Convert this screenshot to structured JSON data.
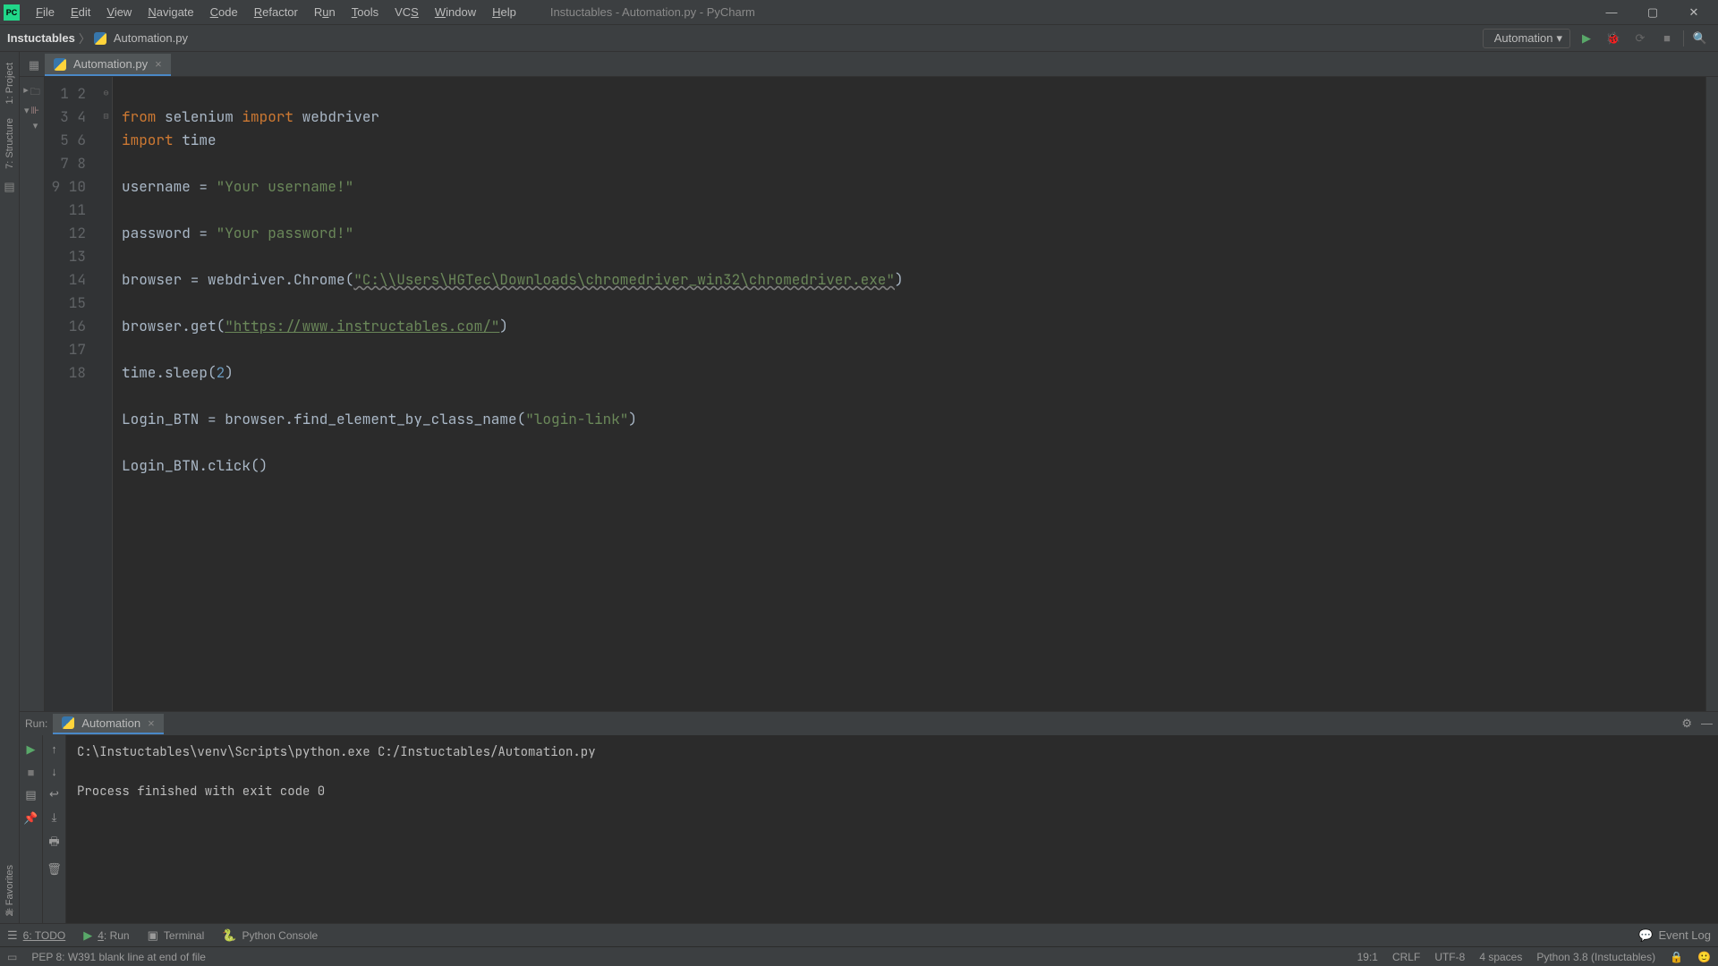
{
  "app": {
    "title": "Instuctables - Automation.py - PyCharm",
    "icon_label": "PC"
  },
  "menu": {
    "file": "File",
    "edit": "Edit",
    "view": "View",
    "navigate": "Navigate",
    "code": "Code",
    "refactor": "Refactor",
    "run": "Run",
    "tools": "Tools",
    "vcs": "VCS",
    "window": "Window",
    "help": "Help"
  },
  "breadcrumb": {
    "project": "Instuctables",
    "file": "Automation.py"
  },
  "toolbar": {
    "run_config": "Automation",
    "play": "▶",
    "debug": "⬢",
    "attach": "⟳",
    "stop": "■",
    "search": "🔍"
  },
  "gutter": {
    "project": "1: Project",
    "structure": "7: Structure",
    "favorites": "2: Favorites"
  },
  "tabs": {
    "file": "Automation.py"
  },
  "code": {
    "lines": [
      {
        "n": "1",
        "raw": ""
      },
      {
        "n": "2",
        "tokens": [
          {
            "t": "from ",
            "c": "tok-kw"
          },
          {
            "t": "selenium ",
            "c": ""
          },
          {
            "t": "import ",
            "c": "tok-kw"
          },
          {
            "t": "webdriver",
            "c": ""
          }
        ]
      },
      {
        "n": "3",
        "tokens": [
          {
            "t": "import ",
            "c": "tok-kw"
          },
          {
            "t": "time",
            "c": ""
          }
        ]
      },
      {
        "n": "4",
        "raw": ""
      },
      {
        "n": "5",
        "tokens": [
          {
            "t": "username = ",
            "c": ""
          },
          {
            "t": "\"Your username!\"",
            "c": "tok-str"
          }
        ]
      },
      {
        "n": "6",
        "raw": ""
      },
      {
        "n": "7",
        "tokens": [
          {
            "t": "password = ",
            "c": ""
          },
          {
            "t": "\"Your password!\"",
            "c": "tok-str"
          }
        ]
      },
      {
        "n": "8",
        "raw": ""
      },
      {
        "n": "9",
        "tokens": [
          {
            "t": "browser = webdriver.Chrome(",
            "c": ""
          },
          {
            "t": "\"C:\\\\Users\\HGTec\\Downloads\\chromedriver_win32\\chromedriver.exe\"",
            "c": "tok-path"
          },
          {
            "t": ")",
            "c": ""
          }
        ]
      },
      {
        "n": "10",
        "raw": ""
      },
      {
        "n": "11",
        "tokens": [
          {
            "t": "browser.get(",
            "c": ""
          },
          {
            "t": "\"https://www.instructables.com/\"",
            "c": "tok-url"
          },
          {
            "t": ")",
            "c": ""
          }
        ]
      },
      {
        "n": "12",
        "raw": ""
      },
      {
        "n": "13",
        "tokens": [
          {
            "t": "time.sleep(",
            "c": ""
          },
          {
            "t": "2",
            "c": "tok-num"
          },
          {
            "t": ")",
            "c": ""
          }
        ]
      },
      {
        "n": "14",
        "raw": ""
      },
      {
        "n": "15",
        "tokens": [
          {
            "t": "Login_BTN = browser.find_element_by_class_name(",
            "c": ""
          },
          {
            "t": "\"login-link\"",
            "c": "tok-str"
          },
          {
            "t": ")",
            "c": ""
          }
        ]
      },
      {
        "n": "16",
        "raw": ""
      },
      {
        "n": "17",
        "tokens": [
          {
            "t": "Login_BTN.click()",
            "c": ""
          }
        ]
      },
      {
        "n": "18",
        "raw": ""
      }
    ]
  },
  "run": {
    "label": "Run:",
    "tab": "Automation",
    "output_line1": "C:\\Instuctables\\venv\\Scripts\\python.exe C:/Instuctables/Automation.py",
    "output_line2": "",
    "output_line3": "Process finished with exit code 0"
  },
  "bottom": {
    "todo": "6: TODO",
    "run": "4: Run",
    "terminal": "Terminal",
    "python_console": "Python Console",
    "event_log": "Event Log"
  },
  "status": {
    "message": "PEP 8: W391 blank line at end of file",
    "pos": "19:1",
    "crlf": "CRLF",
    "enc": "UTF-8",
    "indent": "4 spaces",
    "interp": "Python 3.8 (Instuctables)"
  }
}
